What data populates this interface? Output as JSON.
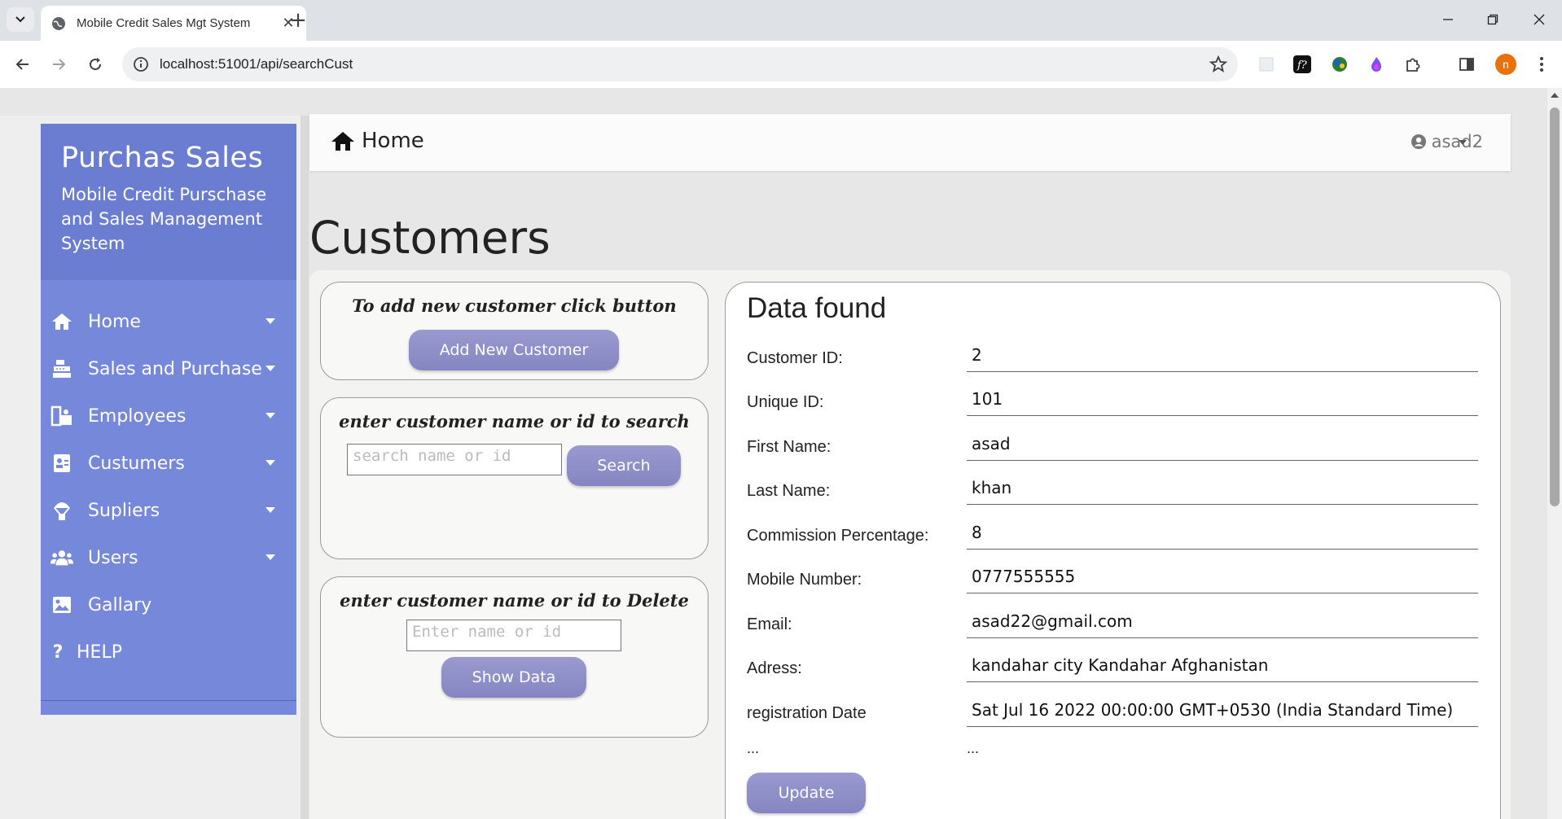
{
  "browser": {
    "tab_title": "Mobile Credit Sales Mgt System",
    "url": "localhost:51001/api/searchCust",
    "profile_initial": "n"
  },
  "sidebar": {
    "title": "Purchas Sales",
    "subtitle": "Mobile Credit Purschase and Sales Management System",
    "items": [
      {
        "label": "Home",
        "icon": "home-icon",
        "caret": true
      },
      {
        "label": "Sales and Purchase",
        "icon": "cash-register-icon",
        "caret": true
      },
      {
        "label": "Employees",
        "icon": "employee-icon",
        "caret": true
      },
      {
        "label": "Custumers",
        "icon": "id-card-icon",
        "caret": true
      },
      {
        "label": "Supliers",
        "icon": "parachute-box-icon",
        "caret": true
      },
      {
        "label": "Users",
        "icon": "users-icon",
        "caret": true
      },
      {
        "label": "Gallary",
        "icon": "image-icon",
        "caret": false
      },
      {
        "label": "HELP",
        "icon": "question-icon",
        "caret": false
      }
    ]
  },
  "topnav": {
    "home_label": "Home",
    "user_label": "asad2"
  },
  "page": {
    "title": "Customers"
  },
  "add_card": {
    "heading": "To add new customer click button",
    "button_label": "Add New Customer"
  },
  "search_card": {
    "heading": "enter customer name or id to search",
    "placeholder": "search name or id",
    "button_label": "Search"
  },
  "delete_card": {
    "heading": "enter customer name or id to Delete",
    "placeholder": "Enter name or id",
    "button_label": "Show Data"
  },
  "data_card": {
    "title": "Data found",
    "rows": [
      {
        "label": "Customer ID:",
        "value": "2"
      },
      {
        "label": "Unique ID:",
        "value": "101"
      },
      {
        "label": "First Name:",
        "value": "asad"
      },
      {
        "label": "Last Name:",
        "value": "khan"
      },
      {
        "label": "Commission Percentage:",
        "value": "8"
      },
      {
        "label": "Mobile Number:",
        "value": "0777555555"
      },
      {
        "label": "Email:",
        "value": "asad22@gmail.com"
      },
      {
        "label": "Adress:",
        "value": "kandahar city Kandahar Afghanistan"
      },
      {
        "label": "registration Date",
        "value": "Sat Jul 16 2022 00:00:00 GMT+0530 (India Standard Time)"
      }
    ],
    "ellipsis_label": "...",
    "ellipsis_value": "...",
    "update_label": "Update"
  }
}
